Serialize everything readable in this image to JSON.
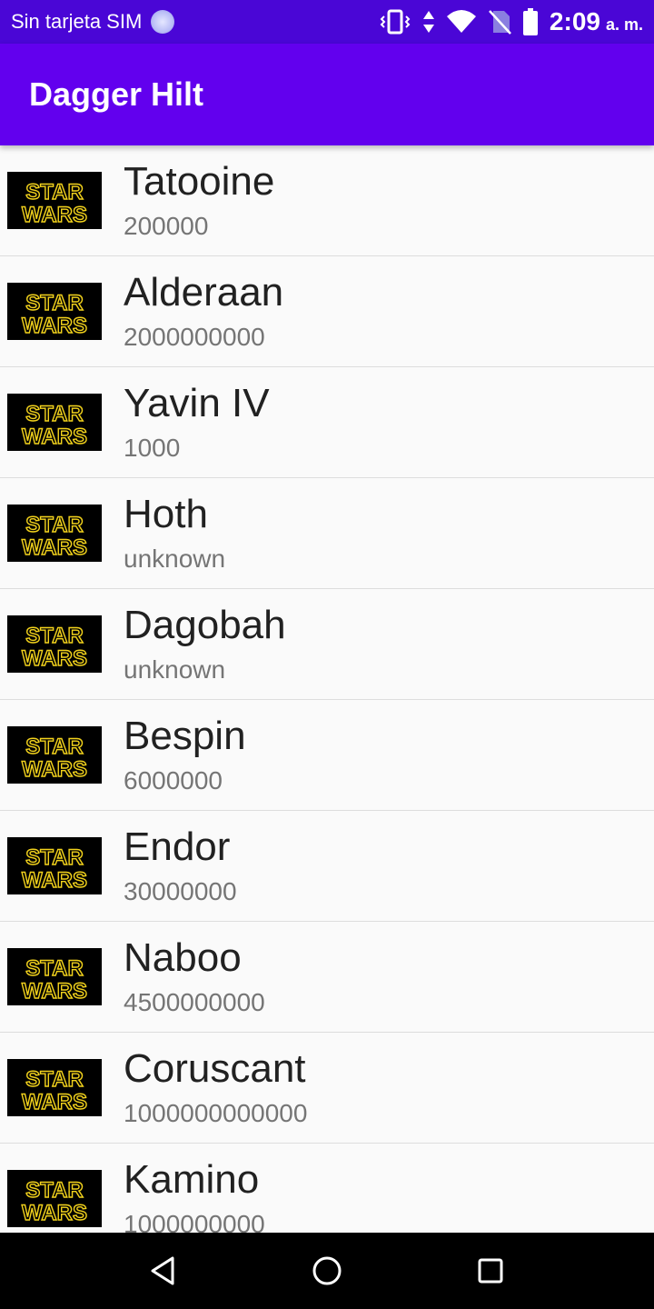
{
  "status_bar": {
    "carrier": "Sin tarjeta SIM",
    "time": "2:09",
    "ampm": "a. m.",
    "icons": [
      "sim-loading-icon",
      "vibrate-icon",
      "data-arrows-icon",
      "wifi-icon",
      "no-sim-icon",
      "battery-icon"
    ]
  },
  "app_bar": {
    "title": "Dagger Hilt"
  },
  "planets": [
    {
      "name": "Tatooine",
      "value": "200000"
    },
    {
      "name": "Alderaan",
      "value": "2000000000"
    },
    {
      "name": "Yavin IV",
      "value": "1000"
    },
    {
      "name": "Hoth",
      "value": "unknown"
    },
    {
      "name": "Dagobah",
      "value": "unknown"
    },
    {
      "name": "Bespin",
      "value": "6000000"
    },
    {
      "name": "Endor",
      "value": "30000000"
    },
    {
      "name": "Naboo",
      "value": "4500000000"
    },
    {
      "name": "Coruscant",
      "value": "1000000000000"
    },
    {
      "name": "Kamino",
      "value": "1000000000"
    }
  ],
  "logo": {
    "line1": "STAR",
    "line2": "WARS",
    "color": "#f2d21c"
  },
  "colors": {
    "status_bar": "#4a06d6",
    "app_bar": "#6200ee",
    "background": "#fafafa"
  }
}
